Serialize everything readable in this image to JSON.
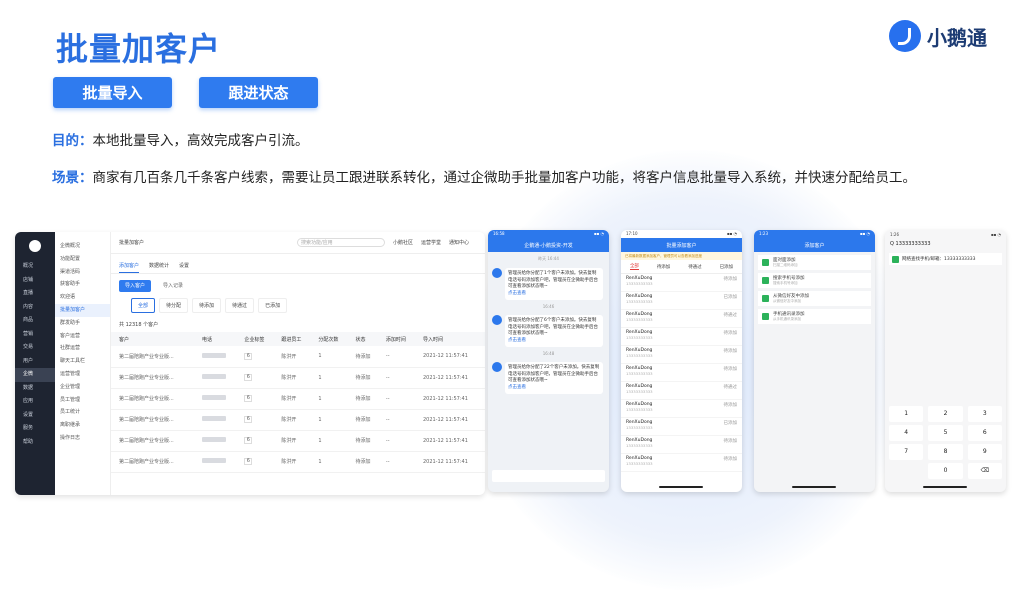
{
  "title": "批量加客户",
  "brand": "小鹅通",
  "buttons": {
    "import": "批量导入",
    "follow": "跟进状态"
  },
  "purpose": {
    "label": "目的：",
    "text": "本地批量导入，高效完成客户引流。"
  },
  "scene": {
    "label": "场景：",
    "text": "商家有几百条几千条客户线索，需要让员工跟进联系转化，通过企微助手批量加客户功能，将客户信息批量导入系统，并快速分配给员工。"
  },
  "desktop": {
    "nav": [
      "概况",
      "店铺",
      "直播",
      "内容",
      "商品",
      "营销",
      "交易",
      "用户",
      "企微",
      "数据",
      "应用",
      "设置",
      "服务",
      "帮助"
    ],
    "nav_active": 8,
    "sub": [
      "企微概况",
      "功能配置",
      "渠道活码",
      "获客助手",
      "欢迎语",
      "批量加客户",
      "群发助手",
      "客户运营",
      "社群运营",
      "聊天工具栏",
      "运营管理",
      "企业管理",
      "员工管理",
      "员工统计",
      "离职继承",
      "操作日志"
    ],
    "sub_active": 5,
    "crumb": "批量加客户",
    "search_placeholder": "搜索功能/应用",
    "top_links": [
      "小鹅社区",
      "运营学堂",
      "通知中心"
    ],
    "tabs": [
      "添加客户",
      "数据统计",
      "设置"
    ],
    "tab_active": 0,
    "actions": {
      "primary": "导入客户",
      "secondary": "导入记录"
    },
    "stats": [
      "全部",
      "待分配",
      "待添加",
      "待通过",
      "已添加"
    ],
    "stat_active": 0,
    "total": "共 12318 个客户",
    "columns": [
      "客户",
      "电话",
      "企业标签",
      "跟进员工",
      "分配次数",
      "状态",
      "添加时间",
      "导入时间"
    ],
    "rows": [
      {
        "customer": "第二届陪跑产业专业版...",
        "tag": "6",
        "staff": "陈洪开",
        "times": "1",
        "status": "待添加",
        "added": "--",
        "imported": "2021-12 11:57:41"
      },
      {
        "customer": "第二届陪跑产业专业版...",
        "tag": "6",
        "staff": "陈洪开",
        "times": "1",
        "status": "待添加",
        "added": "--",
        "imported": "2021-12 11:57:41"
      },
      {
        "customer": "第二届陪跑产业专业版...",
        "tag": "6",
        "staff": "陈洪开",
        "times": "1",
        "status": "待添加",
        "added": "--",
        "imported": "2021-12 11:57:41"
      },
      {
        "customer": "第二届陪跑产业专业版...",
        "tag": "6",
        "staff": "陈洪开",
        "times": "1",
        "status": "待添加",
        "added": "--",
        "imported": "2021-12 11:57:41"
      },
      {
        "customer": "第二届陪跑产业专业版...",
        "tag": "6",
        "staff": "陈洪开",
        "times": "1",
        "status": "待添加",
        "added": "--",
        "imported": "2021-12 11:57:41"
      },
      {
        "customer": "第二届陪跑产业专业版...",
        "tag": "6",
        "staff": "陈洪开",
        "times": "1",
        "status": "待添加",
        "added": "--",
        "imported": "2021-12 11:57:41"
      }
    ]
  },
  "phone1": {
    "time": "16:58",
    "header": "企鹅通-小鹅投资-开发",
    "messages": [
      {
        "time": "昨天 16:44",
        "text": "管理员给你分配了1个客户未添加。快去复制电话号码添加客户吧，管理员在企微助手后台可查看添加状态哦~",
        "link": "点击查看"
      },
      {
        "time": "16:46",
        "text": "管理员给你分配了6个客户未添加。快去复制电话号码添加客户吧，管理员在企微助手后台可查看添加状态哦~",
        "link": "点击查看"
      },
      {
        "time": "16:48",
        "text": "管理员给你分配了22个客户未添加。快去复制电话号码添加客户吧，管理员在企微助手后台可查看添加状态哦~",
        "link": "点击查看"
      }
    ]
  },
  "phone2": {
    "time": "17:10",
    "header": "批量添加客户",
    "banner": "已将最新数据添加客户，管理员可以查看添加进度",
    "tabs": [
      "全部",
      "待添加",
      "待通过",
      "已添加"
    ],
    "tab_active": 0,
    "rows": [
      {
        "name": "RenXuDong",
        "phone": "13333333333",
        "state": "待添加"
      },
      {
        "name": "RenXuDong",
        "phone": "13333333333",
        "state": "已添加"
      },
      {
        "name": "RenXuDong",
        "phone": "13333333333",
        "state": "待通过"
      },
      {
        "name": "RenXuDong",
        "phone": "13333333333",
        "state": "待添加"
      },
      {
        "name": "RenXuDong",
        "phone": "13333333333",
        "state": "待添加"
      },
      {
        "name": "RenXuDong",
        "phone": "13333333333",
        "state": "待添加"
      },
      {
        "name": "RenXuDong",
        "phone": "13333333333",
        "state": "待通过"
      },
      {
        "name": "RenXuDong",
        "phone": "13333333333",
        "state": "待添加"
      },
      {
        "name": "RenXuDong",
        "phone": "13333333333",
        "state": "已添加"
      },
      {
        "name": "RenXuDong",
        "phone": "13333333333",
        "state": "待添加"
      },
      {
        "name": "RenXuDong",
        "phone": "13333333333",
        "state": "待添加"
      }
    ]
  },
  "phone3": {
    "time": "1:23",
    "header": "添加客户",
    "options": [
      {
        "title": "面对面添加",
        "desc": "扫描二维码添加"
      },
      {
        "title": "搜索手机号添加",
        "desc": "搜索手机号添加"
      },
      {
        "title": "从微信好友中添加",
        "desc": "从微信好友中添加"
      },
      {
        "title": "手机通讯录添加",
        "desc": "从手机通讯录添加"
      }
    ]
  },
  "phone4": {
    "time": "1:26",
    "number": "13333333333",
    "found": "网络查找手机/邮箱：13333333333",
    "keys": [
      "1",
      "2",
      "3",
      "4",
      "5",
      "6",
      "7",
      "8",
      "9",
      "",
      "0",
      "⌫"
    ]
  }
}
